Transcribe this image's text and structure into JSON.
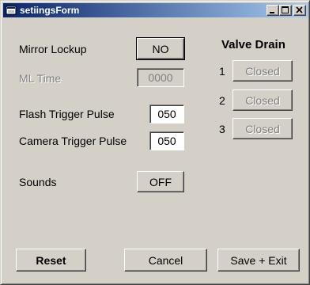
{
  "window": {
    "title": "setiingsForm"
  },
  "settings": {
    "mirror_lockup_label": "Mirror Lockup",
    "mirror_lockup_value": "NO",
    "ml_time_label": "ML Time",
    "ml_time_value": "0000",
    "flash_trigger_label": "Flash Trigger Pulse",
    "flash_trigger_value": "050",
    "camera_trigger_label": "Camera Trigger Pulse",
    "camera_trigger_value": "050",
    "sounds_label": "Sounds",
    "sounds_value": "OFF"
  },
  "valve_drain": {
    "title": "Valve Drain",
    "valves": [
      {
        "number": "1",
        "state": "Closed"
      },
      {
        "number": "2",
        "state": "Closed"
      },
      {
        "number": "3",
        "state": "Closed"
      }
    ]
  },
  "footer": {
    "reset_label": "Reset",
    "cancel_label": "Cancel",
    "save_exit_label": "Save + Exit"
  },
  "colors": {
    "titlebar_start": "#0a246a",
    "titlebar_end": "#a6caf0",
    "face": "#d4d0c8"
  }
}
